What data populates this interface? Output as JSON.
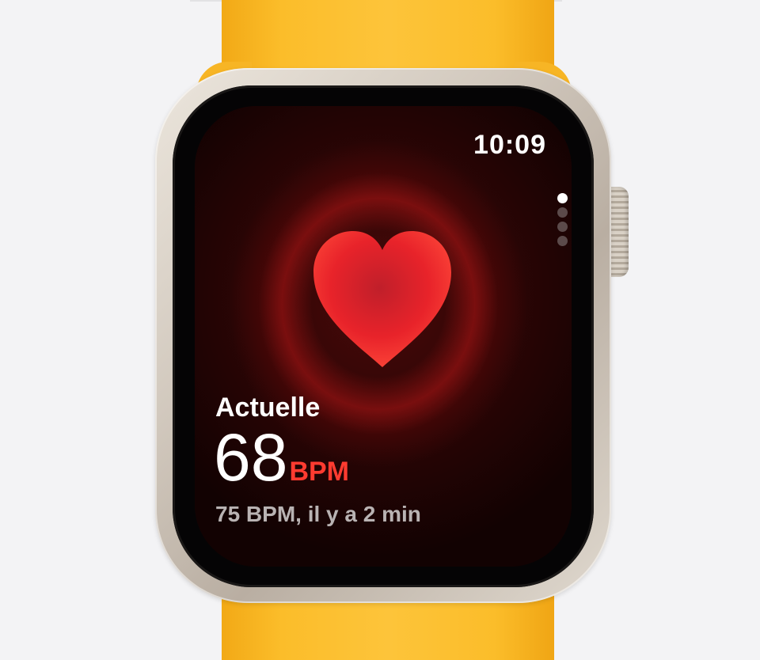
{
  "status_bar": {
    "time": "10:09"
  },
  "page_indicator": {
    "total": 4,
    "active": 1
  },
  "heart_rate": {
    "label": "Actuelle",
    "value": "68",
    "unit": "BPM",
    "previous": "75 BPM, il y a 2 min"
  },
  "colors": {
    "band": "#fdc43a",
    "case": "#d2c9be",
    "heart": "#e8232a",
    "unit_accent": "#ff3b30"
  },
  "icons": {
    "heart": "heart-icon",
    "crown": "digital-crown"
  }
}
